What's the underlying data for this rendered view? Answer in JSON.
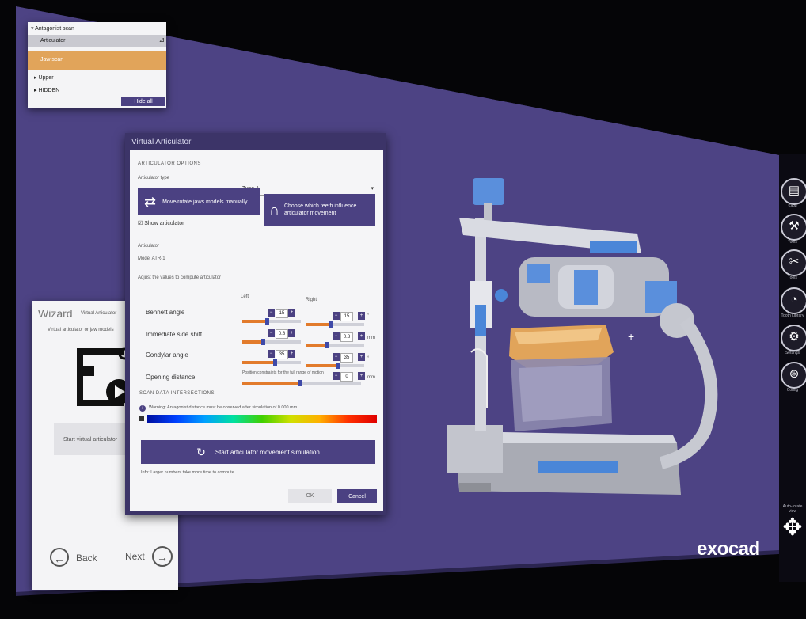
{
  "colors": {
    "app_bg": "#4d4384",
    "accent": "#4b4182",
    "highlight": "#e1a45a",
    "slider_fill": "#e27b2c",
    "slider_knob": "#3f4aa8"
  },
  "object_panel": {
    "items": [
      {
        "label": "Antagonist scan",
        "arrow": "▾"
      },
      {
        "label": "Articulator"
      },
      {
        "label": "Jaw scan",
        "highlighted": true
      },
      {
        "label": "Upper",
        "arrow": "▸"
      },
      {
        "label": "HIDDEN",
        "arrow": "▸"
      }
    ],
    "button": "Hide all",
    "pin": "⊿"
  },
  "articulator_dialog": {
    "title": "Virtual Articulator",
    "section_options": "ARTICULATOR OPTIONS",
    "type_label": "Articulator type",
    "type_value": "Type A",
    "btn_jaw_label": "Move/rotate jaws models manually",
    "btn_jaw_icon": "⇄",
    "btn_influence_label": "Choose which teeth influence articulator movement",
    "btn_influence_icon": "∩",
    "checkbox_label": "Show articulator",
    "subsection": "Articulator",
    "model_line": "Model ATR-1",
    "adjust_label": "Adjust the values to compute articulator",
    "col_left": "Left",
    "col_right": "Right",
    "params": [
      {
        "name": "Bennett angle",
        "left": "15",
        "right": "15",
        "left_pct": 0.42,
        "right_pct": 0.42,
        "unit": "°"
      },
      {
        "name": "Immediate side shift",
        "left": "0.8",
        "right": "0.8",
        "left_pct": 0.35,
        "right_pct": 0.35,
        "unit": "mm"
      },
      {
        "name": "Condylar angle",
        "left": "35",
        "right": "35",
        "left_pct": 0.55,
        "right_pct": 0.55,
        "unit": "°"
      },
      {
        "name": "Opening distance",
        "left": "0",
        "right": "",
        "left_pct": 0.48,
        "right_pct": 0,
        "unit": "mm",
        "note": "Position constraints for the full range of motion"
      }
    ],
    "section_scan": "SCAN DATA INTERSECTIONS",
    "warning": "Warning: Antagonist distance must be observed after simulation of 0.000 mm",
    "warning_icon": "i",
    "simulate_label": "Start articulator movement simulation",
    "simulate_icon": "↻",
    "info_note": "Info: Larger numbers take more time to compute",
    "ok_label": "OK",
    "cancel_label": "Cancel"
  },
  "wizard": {
    "title": "Wizard",
    "subtitle": "Virtual Articulator",
    "desc": "Virtual articulator or jaw models",
    "start_label": "Start virtual articulator",
    "back_label": "Back",
    "next_label": "Next",
    "back_icon": "←",
    "next_icon": "→"
  },
  "right_toolbar": {
    "items": [
      {
        "icon": "save-icon",
        "glyph": "▤",
        "label": "Save"
      },
      {
        "icon": "wrench-icon",
        "glyph": "⚒",
        "label": "Tools"
      },
      {
        "icon": "tools-icon",
        "glyph": "✂",
        "label": "Tools"
      },
      {
        "icon": "tooth-icon",
        "glyph": "◔",
        "label": "Tooth Library"
      },
      {
        "icon": "settings-icon",
        "glyph": "⚙",
        "label": "Settings"
      },
      {
        "icon": "gear-icon",
        "glyph": "⊛",
        "label": "Config"
      }
    ],
    "view_label": "Auto-rotate view",
    "arrows_glyph": "✥"
  },
  "brand": "exocad"
}
